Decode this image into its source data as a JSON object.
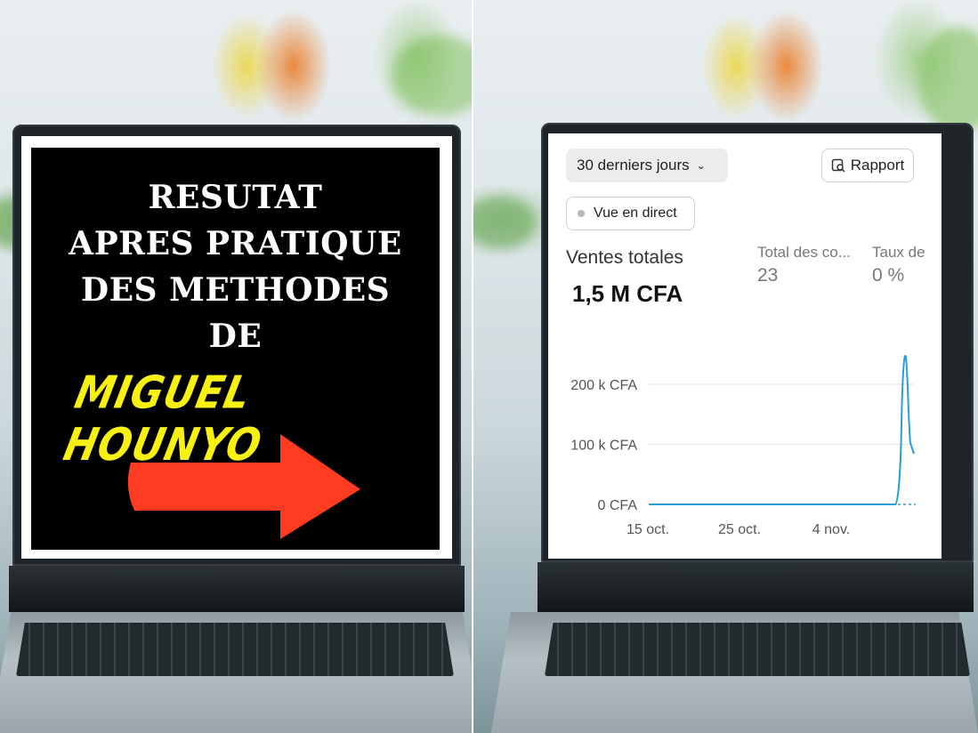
{
  "promo": {
    "line1": "RESUTAT",
    "line2": "APRES PRATIQUE",
    "line3": "DES METHODES",
    "line4": "DE",
    "name": "MIGUEL HOUNYO",
    "arrow_icon": "right-arrow-icon",
    "arrow_color": "#ff3b21",
    "name_color": "#f7f012"
  },
  "dashboard": {
    "period_selector": "30 derniers jours",
    "report_button": "Rapport",
    "live_view": "Vue en direct",
    "total_sales_label": "Ventes totales",
    "total_sales_value": "1,5 M CFA",
    "orders_label": "Total des co...",
    "orders_value": "23",
    "rate_label": "Taux de",
    "rate_value": "0 %",
    "accent": "#2a9fd6"
  },
  "chart_data": {
    "type": "line",
    "x": [
      "15 oct.",
      "25 oct.",
      "4 nov."
    ],
    "yticks": [
      "200 k CFA",
      "100 k CFA",
      "0 CFA"
    ],
    "ylim": [
      0,
      250000
    ],
    "grid": true
  }
}
